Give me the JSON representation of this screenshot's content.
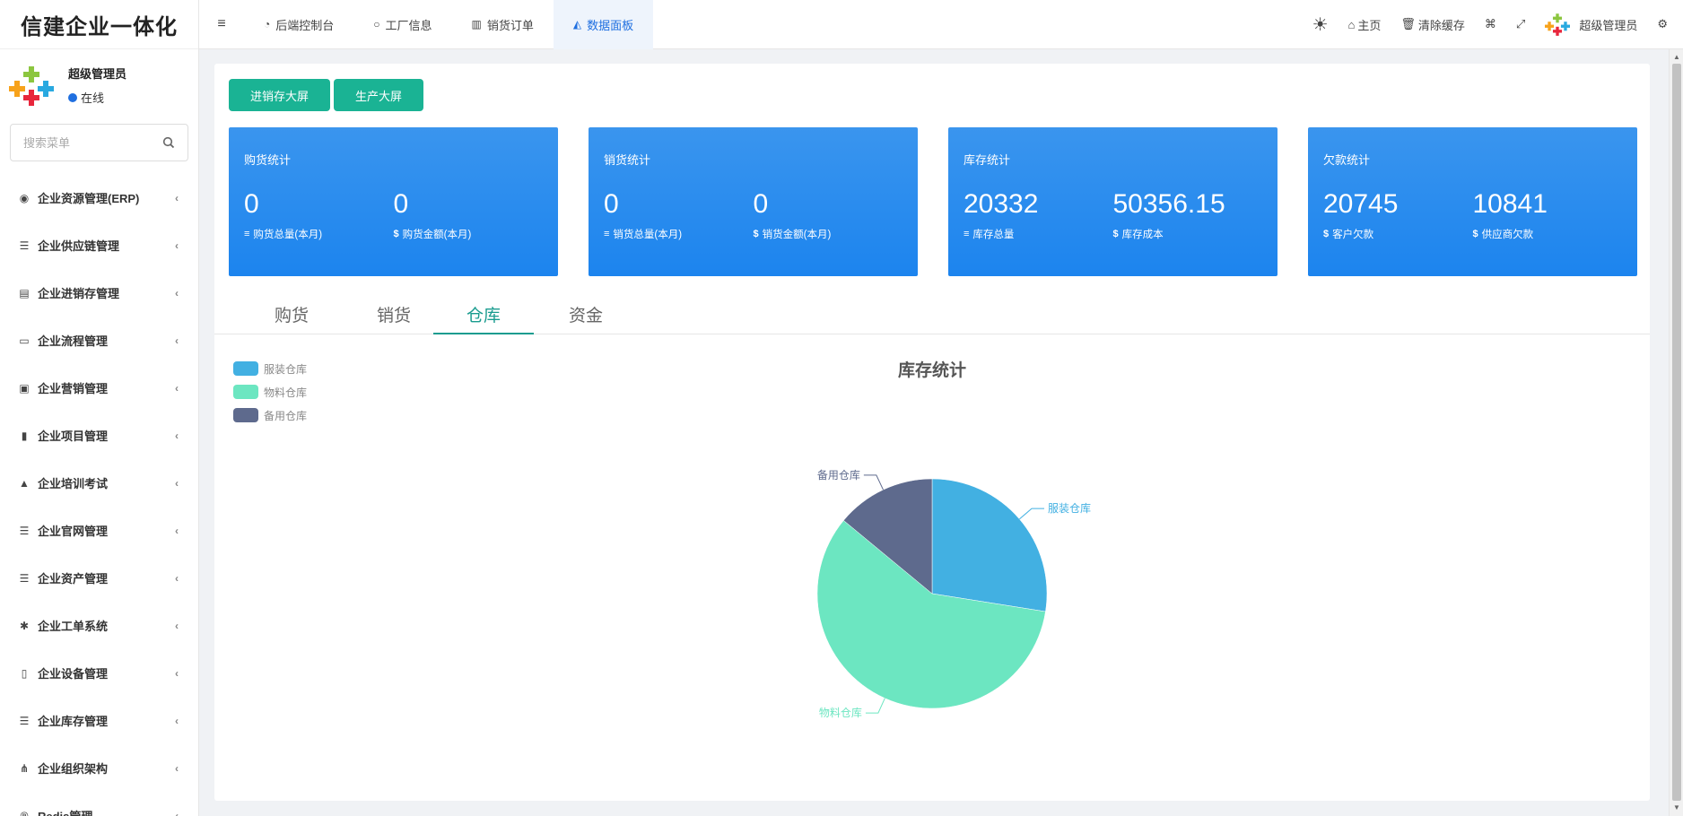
{
  "brand": {
    "title": "信建企业一体化"
  },
  "user": {
    "name": "超级管理员",
    "status": "在线"
  },
  "search": {
    "placeholder": "搜索菜单"
  },
  "menu": [
    {
      "label": "企业资源管理(ERP)",
      "icon": "globe-icon"
    },
    {
      "label": "企业供应链管理",
      "icon": "list-icon"
    },
    {
      "label": "企业进销存管理",
      "icon": "document-icon"
    },
    {
      "label": "企业流程管理",
      "icon": "calendar-icon"
    },
    {
      "label": "企业营销管理",
      "icon": "id-card-icon"
    },
    {
      "label": "企业项目管理",
      "icon": "book-icon"
    },
    {
      "label": "企业培训考试",
      "icon": "graduation-cap-icon"
    },
    {
      "label": "企业官网管理",
      "icon": "list-icon"
    },
    {
      "label": "企业资产管理",
      "icon": "list-icon"
    },
    {
      "label": "企业工单系统",
      "icon": "asterisk-icon"
    },
    {
      "label": "企业设备管理",
      "icon": "mobile-icon"
    },
    {
      "label": "企业库存管理",
      "icon": "list-icon"
    },
    {
      "label": "企业组织架构",
      "icon": "sitemap-icon"
    },
    {
      "label": "Redis管理",
      "icon": "registered-icon"
    }
  ],
  "topnav": {
    "tabs": [
      {
        "label": "后端控制台",
        "icon": "dashboard-icon"
      },
      {
        "label": "工厂信息",
        "icon": "circle-icon"
      },
      {
        "label": "销货订单",
        "icon": "bar-chart-icon"
      },
      {
        "label": "数据面板",
        "icon": "area-chart-icon",
        "active": true
      }
    ],
    "right": {
      "home": "主页",
      "clear_cache": "清除缓存",
      "admin": "超级管理员"
    }
  },
  "actions": {
    "btn1": "进销存大屏",
    "btn2": "生产大屏"
  },
  "cards": [
    {
      "title": "购货统计",
      "v1": "0",
      "l1": "购货总量(本月)",
      "v2": "0",
      "l2": "购货金额(本月)"
    },
    {
      "title": "销货统计",
      "v1": "0",
      "l1": "销货总量(本月)",
      "v2": "0",
      "l2": "销货金额(本月)"
    },
    {
      "title": "库存统计",
      "v1": "20332",
      "l1": "库存总量",
      "v2": "50356.15",
      "l2": "库存成本"
    },
    {
      "title": "欠款统计",
      "v1": "20745",
      "l1": "客户欠款",
      "v2": "10841",
      "l2": "供应商欠款"
    }
  ],
  "content_tabs": [
    "购货",
    "销货",
    "仓库",
    "资金"
  ],
  "active_content_tab": "仓库",
  "colors": {
    "accent": "#1ab394",
    "card_blue": "#1c84ee",
    "tab_active": "#1a9c8f"
  },
  "chart_data": {
    "type": "pie",
    "title": "库存统计",
    "legend_position": "top-left",
    "slices": [
      {
        "name": "服装仓库",
        "value": 27.5,
        "color": "#42b0e2"
      },
      {
        "name": "物料仓库",
        "value": 58.5,
        "color": "#6ce6c1"
      },
      {
        "name": "备用仓库",
        "value": 14.0,
        "color": "#5e6a8d"
      }
    ]
  }
}
